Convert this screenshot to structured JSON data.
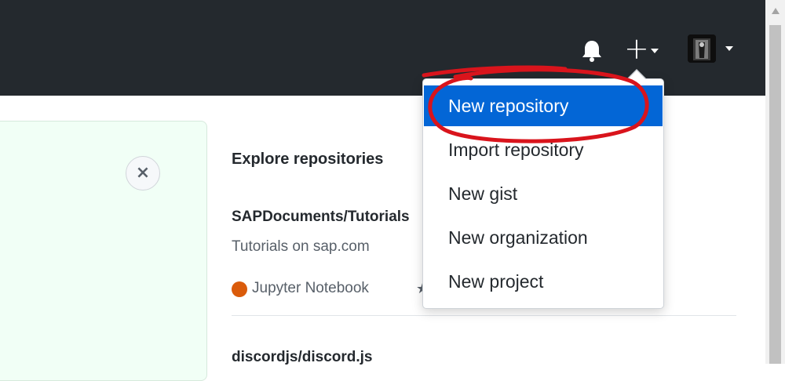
{
  "header": {
    "icons": [
      "bell-icon",
      "plus-icon",
      "chevron-down-icon",
      "avatar"
    ],
    "plus_label": "+"
  },
  "banner": {
    "close_label": "×"
  },
  "explore": {
    "title": "Explore repositories",
    "repos": [
      {
        "name": "SAPDocuments/Tutorials",
        "description": "Tutorials on sap.com",
        "language": "Jupyter Notebook",
        "language_color": "#da5b0b"
      },
      {
        "name": "discordjs/discord.js"
      }
    ]
  },
  "new_menu": {
    "items": [
      {
        "label": "New repository",
        "active": true
      },
      {
        "label": "Import repository",
        "active": false
      },
      {
        "label": "New gist",
        "active": false
      },
      {
        "label": "New organization",
        "active": false
      },
      {
        "label": "New project",
        "active": false
      }
    ]
  },
  "colors": {
    "header_bg": "#24292e",
    "accent": "#0366d6",
    "annotation": "#d9141c"
  }
}
